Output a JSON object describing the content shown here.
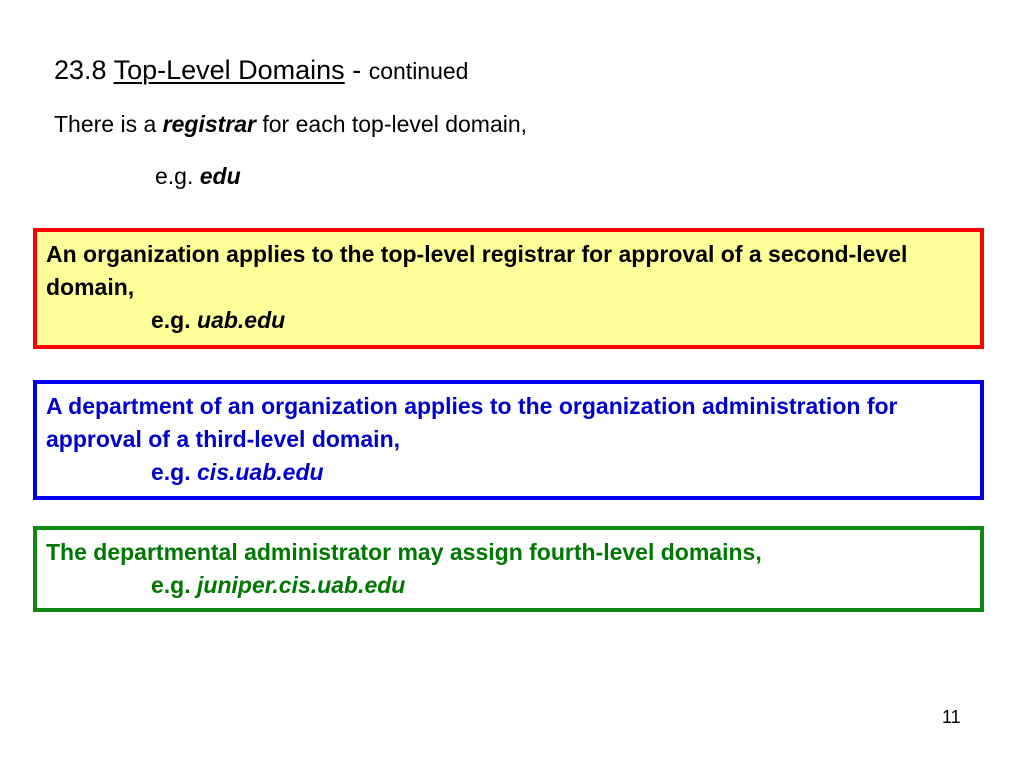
{
  "slide": {
    "title": {
      "section": "23.8",
      "topic": "Top-Level Domains",
      "separator": "-",
      "suffix": "continued"
    },
    "intro": {
      "before": "There is a",
      "term": "registrar",
      "after": "for each top-level domain,"
    },
    "example": {
      "prefix": "e.g.",
      "domain": "edu"
    },
    "boxes": [
      {
        "text": "An organization applies to the top-level registrar for approval of a second-level domain,",
        "example_prefix": "e.g.",
        "example_domain": "uab.edu",
        "border_color": "#ff0000",
        "background": "#ffff99",
        "text_color": "#000000"
      },
      {
        "text": "A department of an organization applies to the organization administration for approval of a third-level domain,",
        "example_prefix": "e.g.",
        "example_domain": "cis.uab.edu",
        "border_color": "#0000ee",
        "background": "#ffffff",
        "text_color": "#0000cc"
      },
      {
        "text": "The departmental administrator may assign fourth-level domains,",
        "example_prefix": "e.g.",
        "example_domain": "juniper.cis.uab.edu",
        "border_color": "#118811",
        "background": "#ffffff",
        "text_color": "#007700"
      }
    ],
    "page_number": "11"
  }
}
